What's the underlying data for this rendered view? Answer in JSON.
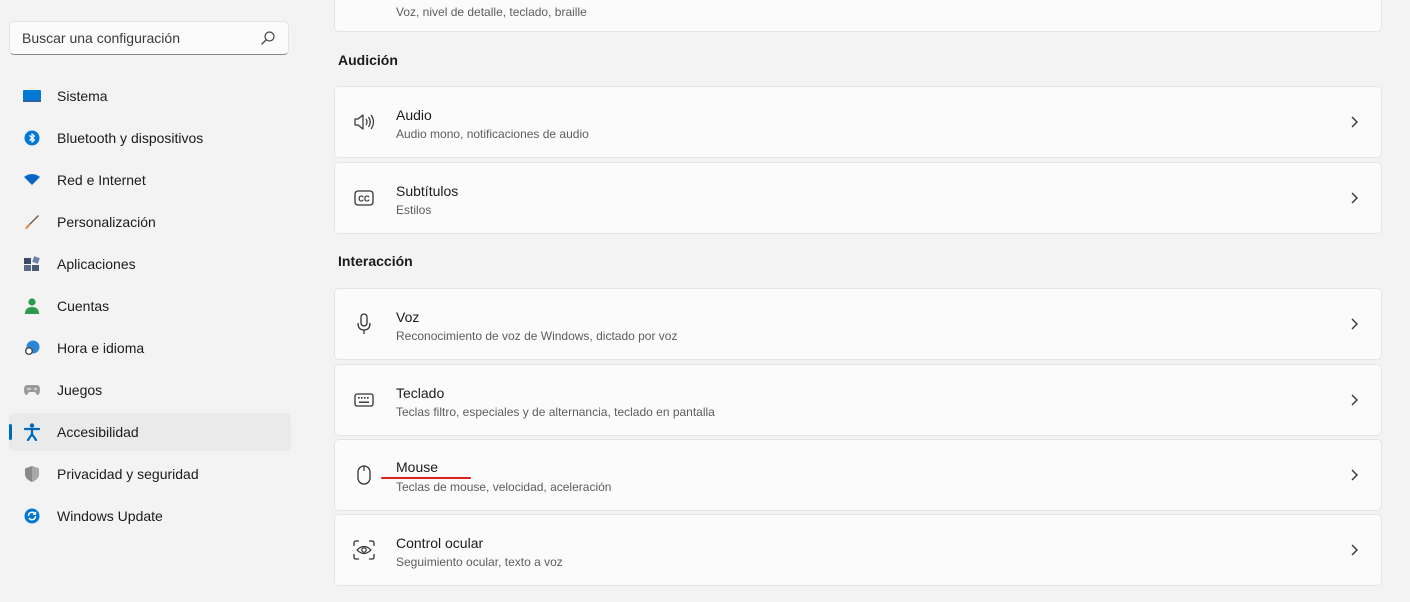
{
  "search": {
    "placeholder": "Buscar una configuración",
    "icon": "search-icon"
  },
  "sidebar": {
    "items": [
      {
        "label": "Sistema",
        "icon": "system-icon"
      },
      {
        "label": "Bluetooth y dispositivos",
        "icon": "bluetooth-icon"
      },
      {
        "label": "Red e Internet",
        "icon": "wifi-icon"
      },
      {
        "label": "Personalización",
        "icon": "brush-icon"
      },
      {
        "label": "Aplicaciones",
        "icon": "apps-icon"
      },
      {
        "label": "Cuentas",
        "icon": "account-icon"
      },
      {
        "label": "Hora e idioma",
        "icon": "globe-clock-icon"
      },
      {
        "label": "Juegos",
        "icon": "gamepad-icon"
      },
      {
        "label": "Accesibilidad",
        "icon": "accessibility-icon",
        "active": true
      },
      {
        "label": "Privacidad y seguridad",
        "icon": "shield-icon"
      },
      {
        "label": "Windows Update",
        "icon": "update-icon"
      }
    ]
  },
  "main": {
    "top_card_partial_text": "Voz, nivel de detalle, teclado, braille",
    "sections": [
      {
        "title": "Audición",
        "cards": [
          {
            "title": "Audio",
            "subtitle": "Audio mono, notificaciones de audio",
            "icon": "speaker-icon"
          },
          {
            "title": "Subtítulos",
            "subtitle": "Estilos",
            "icon": "closed-captions-icon"
          }
        ]
      },
      {
        "title": "Interacción",
        "cards": [
          {
            "title": "Voz",
            "subtitle": "Reconocimiento de voz de Windows, dictado por voz",
            "icon": "microphone-icon"
          },
          {
            "title": "Teclado",
            "subtitle": "Teclas filtro, especiales y de alternancia, teclado en pantalla",
            "icon": "keyboard-icon"
          },
          {
            "title": "Mouse",
            "subtitle": "Teclas de mouse, velocidad, aceleración",
            "icon": "mouse-icon",
            "annotated": true
          },
          {
            "title": "Control ocular",
            "subtitle": "Seguimiento ocular, texto a voz",
            "icon": "eye-control-icon"
          }
        ]
      }
    ]
  },
  "colors": {
    "accent": "#0067c0",
    "annotation": "#e0201b",
    "background": "#f3f3f3",
    "card": "#fbfbfb"
  }
}
